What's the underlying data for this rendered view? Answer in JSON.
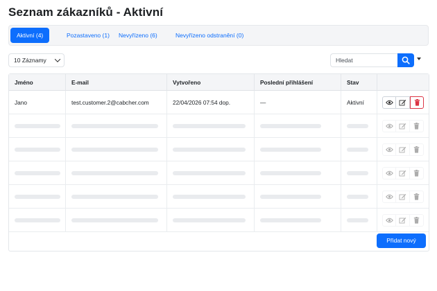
{
  "page": {
    "title": "Seznam zákazníků - Aktivní"
  },
  "tabs": [
    {
      "label": "Aktivní (4)",
      "active": true
    },
    {
      "label": "Pozastaveno (1)",
      "active": false
    },
    {
      "label": "Nevyřízeno (6)",
      "active": false
    },
    {
      "label": "Nevyřízeno odstranění (0)",
      "active": false
    }
  ],
  "toolbar": {
    "page_size": "10 Záznamy",
    "search_placeholder": "Hledat"
  },
  "table": {
    "columns": [
      "Jméno",
      "E-mail",
      "Vytvořeno",
      "Poslední přihlášení",
      "Stav"
    ],
    "rows": [
      {
        "name": "Jano",
        "email": "test.customer.2@cabcher.com",
        "created": "22/04/2026 07:54 dop.",
        "last_login": "—",
        "status": "Aktivní"
      }
    ],
    "placeholder_rows": 5
  },
  "actions": {
    "add_new": "Přidat nový"
  },
  "colors": {
    "primary": "#0d6efd",
    "danger": "#dc3545",
    "skeleton": "#e9ebee"
  },
  "icons": [
    "search-icon",
    "eye-icon",
    "edit-icon",
    "trash-icon",
    "chevron-down-icon"
  ]
}
